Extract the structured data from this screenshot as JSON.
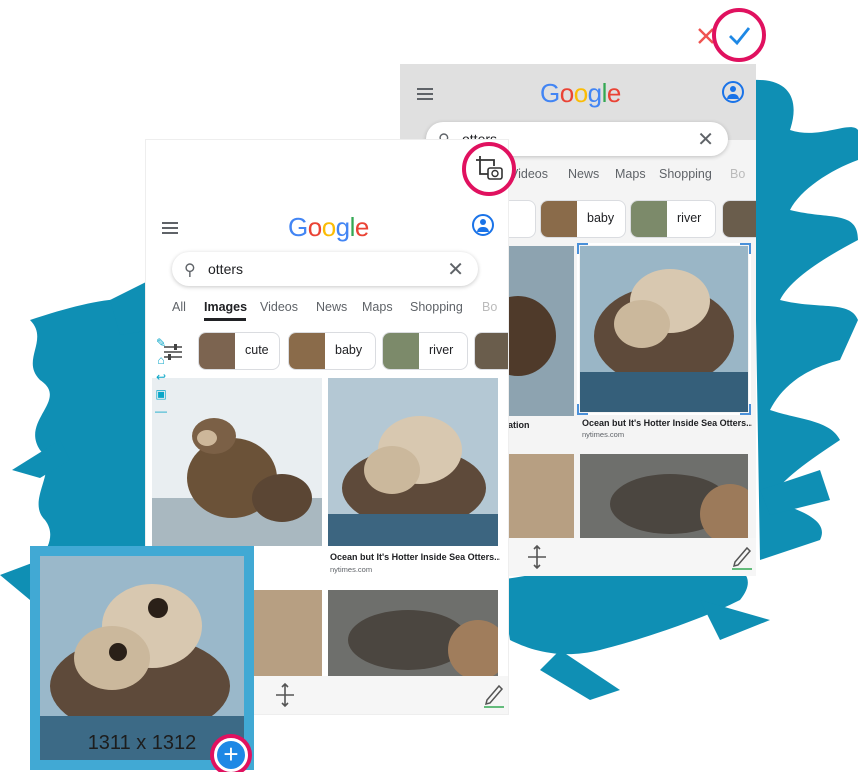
{
  "colors": {
    "accent_ring": "#e0115f",
    "splash": "#0f8fb4",
    "google_blue": "#4285f4",
    "google_red": "#ea4335",
    "google_yellow": "#fbbc05",
    "google_green": "#34a853",
    "confirm_check": "#1e88e5",
    "cancel_x": "#ef5350"
  },
  "icons": {
    "cancel": "close-icon",
    "confirm": "check-icon",
    "crop_snap": "crop-camera-icon",
    "menu": "hamburger-menu-icon",
    "account": "account-circle-icon",
    "search": "search-icon",
    "clear": "clear-icon",
    "filter": "filter-sliders-icon",
    "drag": "drag-move-icon",
    "edit": "pen-icon",
    "add": "plus-circle-icon"
  },
  "app": {
    "logo_letters": [
      "G",
      "o",
      "o",
      "g",
      "l",
      "e"
    ],
    "query": "otters",
    "front_tabs": [
      "All",
      "Images",
      "Videos",
      "News",
      "Maps",
      "Shopping",
      "Bo"
    ],
    "back_tabs": [
      "Videos",
      "News",
      "Maps",
      "Shopping",
      "Bo"
    ],
    "active_tab": "Images",
    "front_chips": [
      "cute",
      "baby",
      "river"
    ],
    "back_chips": [
      "te",
      "baby",
      "river"
    ],
    "result_caption": "Ocean but It's Hotter Inside Sea Otters...",
    "result_source": "nytimes.com",
    "left_caption_fragment": "tion",
    "back_left_caption_fragment": "ation",
    "back_search_query_fragment": "otters"
  },
  "zoom": {
    "dimensions": "1311 x 1312"
  },
  "tools": [
    "pencil-icon",
    "home-icon",
    "undo-icon",
    "screen-icon"
  ]
}
